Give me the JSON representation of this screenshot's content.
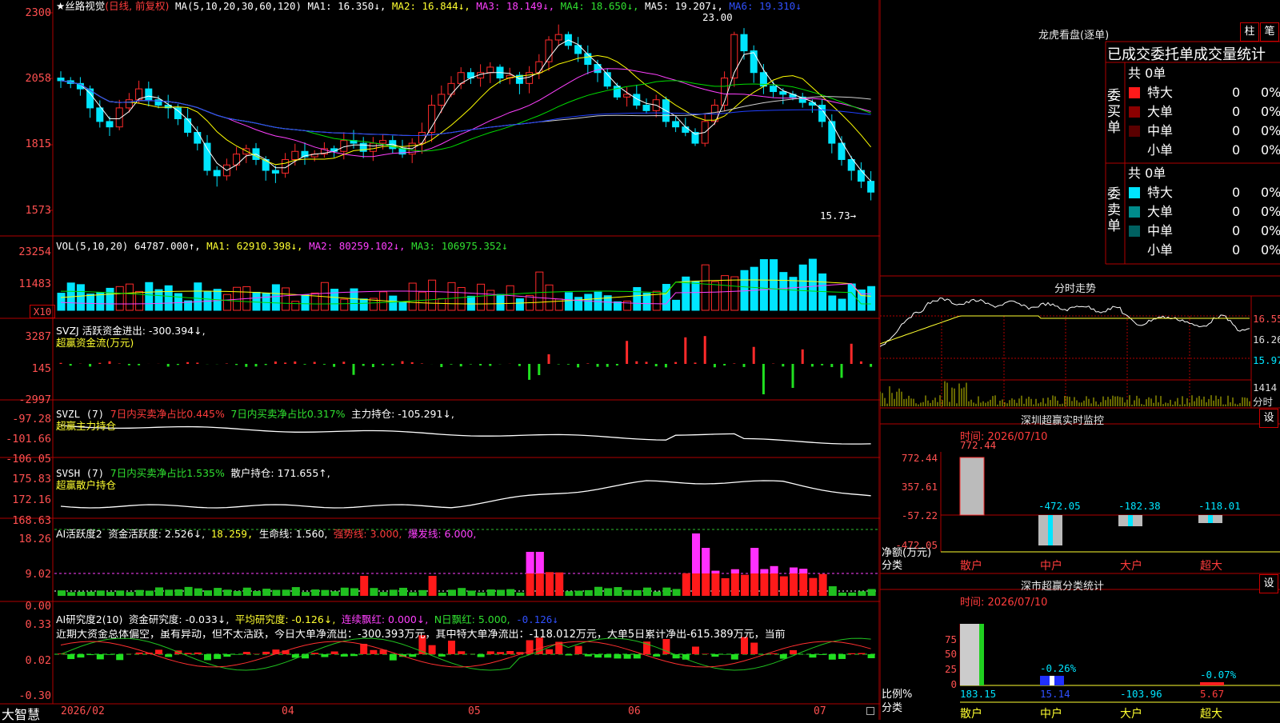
{
  "app": {
    "name": "大智慧"
  },
  "colors": {
    "up": "#ff2a2a",
    "down": "#00e5ff",
    "grid": "#b00000",
    "ma1": "#ffffff",
    "ma2": "#ffff00",
    "ma3": "#ff40ff",
    "ma4": "#00dd00",
    "ma5": "#d0d0d0",
    "ma6": "#2040ff"
  },
  "kline": {
    "title": "★丝路视觉",
    "mode": "(日线, 前复权)",
    "ma_label": "MA(5,10,20,30,60,120)",
    "ma1": "MA1: 16.350↓,",
    "ma2": "MA2: 16.844↓,",
    "ma3": "MA3: 18.149↓,",
    "ma4": "MA4: 18.650↓,",
    "ma5": "MA5: 19.207↓,",
    "ma6": "MA6: 19.310↓",
    "axis": [
      "2300",
      "2058",
      "1815",
      "1573"
    ],
    "high_note": "23.00",
    "low_note": "15.73→"
  },
  "vol": {
    "label": "VOL(5,10,20)",
    "value": "64787.000↑,",
    "ma1": "MA1: 62910.398↓,",
    "ma2": "MA2: 80259.102↓,",
    "ma3": "MA3: 106975.352↓",
    "axis": [
      "23254",
      "11483"
    ],
    "unit": "X10"
  },
  "svzj": {
    "label": "SVZJ  活跃资金进出: -300.394↓,",
    "sub": "超赢资金流(万元)",
    "axis": [
      "3287",
      "145",
      "-2997"
    ]
  },
  "svzl": {
    "label": "SVZL (7)",
    "buy": "7日内买卖净占比0.445%",
    "buy2": "7日内买卖净占比0.317%",
    "hold": "主力持仓: -105.291↓,",
    "sub": "超赢主力持仓",
    "axis": [
      "-97.28",
      "-101.66",
      "-106.05"
    ]
  },
  "svsh": {
    "label": "SVSH (7)",
    "buy": "7日内买卖净占比1.535%",
    "hold": "散户持仓: 171.655↑,",
    "sub": "超赢散户持仓",
    "axis": [
      "175.83",
      "172.16",
      "168.63"
    ]
  },
  "ai2": {
    "label": "AI活跃度2",
    "v1": "资金活跃度: 2.526↓,",
    "v2": "18.259,",
    "v3": "生命线: 1.560,",
    "v4": "强势线: 3.000,",
    "v5": "爆发线: 6.000,",
    "axis": [
      "18.26",
      "9.02",
      "0.00"
    ]
  },
  "ai_research": {
    "label": "AI研究度2(10)",
    "v1": "资金研究度: -0.033↓,",
    "v2": "平均研究度: -0.126↓,",
    "v3": "连续飘红: 0.000↓,",
    "v4": "N日飘红: 5.000,",
    "v5": "-0.126↓",
    "comment": "近期大资金总体偏空，虽有异动，但不太活跃，今日大单净流出：-300.393万元，其中特大单净流出：-118.012万元，大单5日累计净出-615.389万元，当前",
    "axis": [
      "0.33",
      "0.02",
      "-0.30"
    ]
  },
  "dates": [
    "2026/02",
    "04",
    "05",
    "06",
    "07"
  ],
  "lhb": {
    "title": "龙虎看盘(逐单)",
    "btn1": "柱",
    "btn2": "笔",
    "tabs": "已成交委托单成交量统计",
    "buy_side": "委买单",
    "sell_side": "委卖单",
    "buy_total": "共 0单",
    "sell_total": "共 0单",
    "buy_rows": [
      {
        "name": "特大",
        "count": "0",
        "pct": "0%",
        "color": "#ff1a1a"
      },
      {
        "name": "大单",
        "count": "0",
        "pct": "0%",
        "color": "#8b0000"
      },
      {
        "name": "中单",
        "count": "0",
        "pct": "0%",
        "color": "#5a0000"
      },
      {
        "name": "小单",
        "count": "0",
        "pct": "0%",
        "color": ""
      }
    ],
    "sell_rows": [
      {
        "name": "特大",
        "count": "0",
        "pct": "0%",
        "color": "#00e5ff"
      },
      {
        "name": "大单",
        "count": "0",
        "pct": "0%",
        "color": "#008b8b"
      },
      {
        "name": "中单",
        "count": "0",
        "pct": "0%",
        "color": "#006060"
      },
      {
        "name": "小单",
        "count": "0",
        "pct": "0%",
        "color": ""
      }
    ]
  },
  "intraday": {
    "title": "分时走势",
    "axis": [
      "16.55",
      "16.26",
      "15.97"
    ],
    "vol_axis": "1414",
    "unit": "分时"
  },
  "sz_monitor": {
    "title": "深圳超赢实时监控",
    "btn": "设",
    "time": "时间: 2026/07/10",
    "axis": [
      "772.44",
      "357.61",
      "-57.22",
      "-472.05"
    ],
    "ylabel": "净额(万元)",
    "xlabel": "分类",
    "categories": [
      "散户",
      "中户",
      "大户",
      "超大"
    ],
    "values_text": [
      "772.44",
      "-472.05",
      "-182.38",
      "-118.01"
    ]
  },
  "sz_class": {
    "title": "深市超赢分类统计",
    "btn": "设",
    "time": "时间: 2026/07/10",
    "axis": [
      "75",
      "50",
      "25",
      "0"
    ],
    "ylabel": "比例%",
    "xlabel": "分类",
    "categories": [
      "散户",
      "中户",
      "大户",
      "超大"
    ],
    "pct_text": [
      "-0.26%",
      "-0.07%"
    ],
    "values_text": [
      "183.15",
      "15.14",
      "-103.96",
      "5.67"
    ]
  }
}
